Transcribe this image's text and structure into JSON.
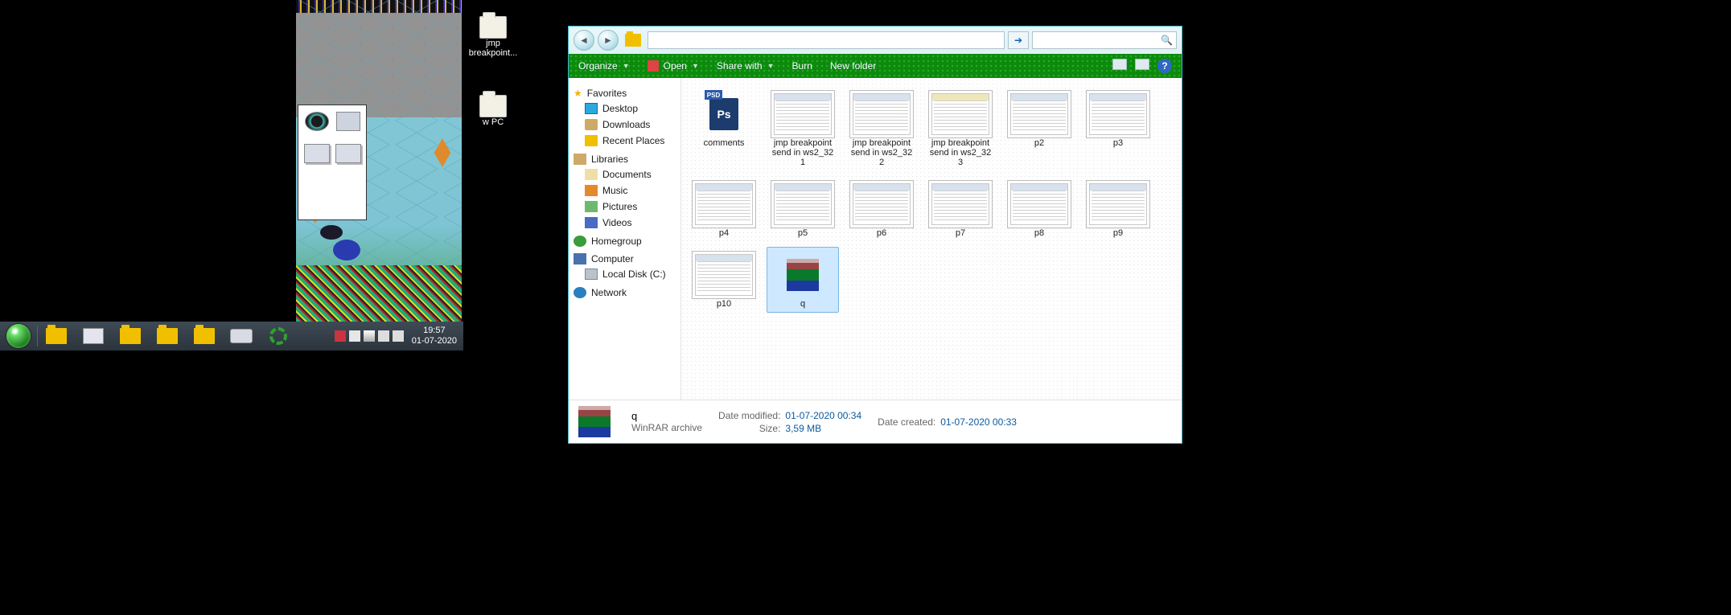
{
  "left": {
    "desktop_icons": [
      {
        "label": "jmp breakpoint..."
      },
      {
        "label": "w PC"
      }
    ],
    "taskbar": {
      "clock_time": "19:57",
      "clock_date": "01-07-2020"
    }
  },
  "explorer": {
    "toolbar": {
      "organize": "Organize",
      "open": "Open",
      "share": "Share with",
      "burn": "Burn",
      "newfolder": "New folder"
    },
    "sidebar": {
      "favorites": "Favorites",
      "fav_items": [
        "Desktop",
        "Downloads",
        "Recent Places"
      ],
      "libraries": "Libraries",
      "lib_items": [
        "Documents",
        "Music",
        "Pictures",
        "Videos"
      ],
      "homegroup": "Homegroup",
      "computer": "Computer",
      "comp_items": [
        "Local Disk (C:)"
      ],
      "network": "Network"
    },
    "files": [
      {
        "name": "comments",
        "kind": "psd"
      },
      {
        "name": "jmp breakpoint send in ws2_32 1",
        "kind": "shot"
      },
      {
        "name": "jmp breakpoint send in ws2_32 2",
        "kind": "shot"
      },
      {
        "name": "jmp breakpoint send in ws2_32 3",
        "kind": "shoty"
      },
      {
        "name": "p2",
        "kind": "shot"
      },
      {
        "name": "p3",
        "kind": "shot"
      },
      {
        "name": "p4",
        "kind": "shot"
      },
      {
        "name": "p5",
        "kind": "shot"
      },
      {
        "name": "p6",
        "kind": "shot"
      },
      {
        "name": "p7",
        "kind": "shot"
      },
      {
        "name": "p8",
        "kind": "shot"
      },
      {
        "name": "p9",
        "kind": "shot"
      },
      {
        "name": "p10",
        "kind": "shot"
      },
      {
        "name": "q",
        "kind": "rar",
        "selected": true
      }
    ],
    "details": {
      "name": "q",
      "type": "WinRAR archive",
      "modified_k": "Date modified:",
      "modified_v": "01-07-2020 00:34",
      "size_k": "Size:",
      "size_v": "3,59 MB",
      "created_k": "Date created:",
      "created_v": "01-07-2020 00:33"
    }
  }
}
